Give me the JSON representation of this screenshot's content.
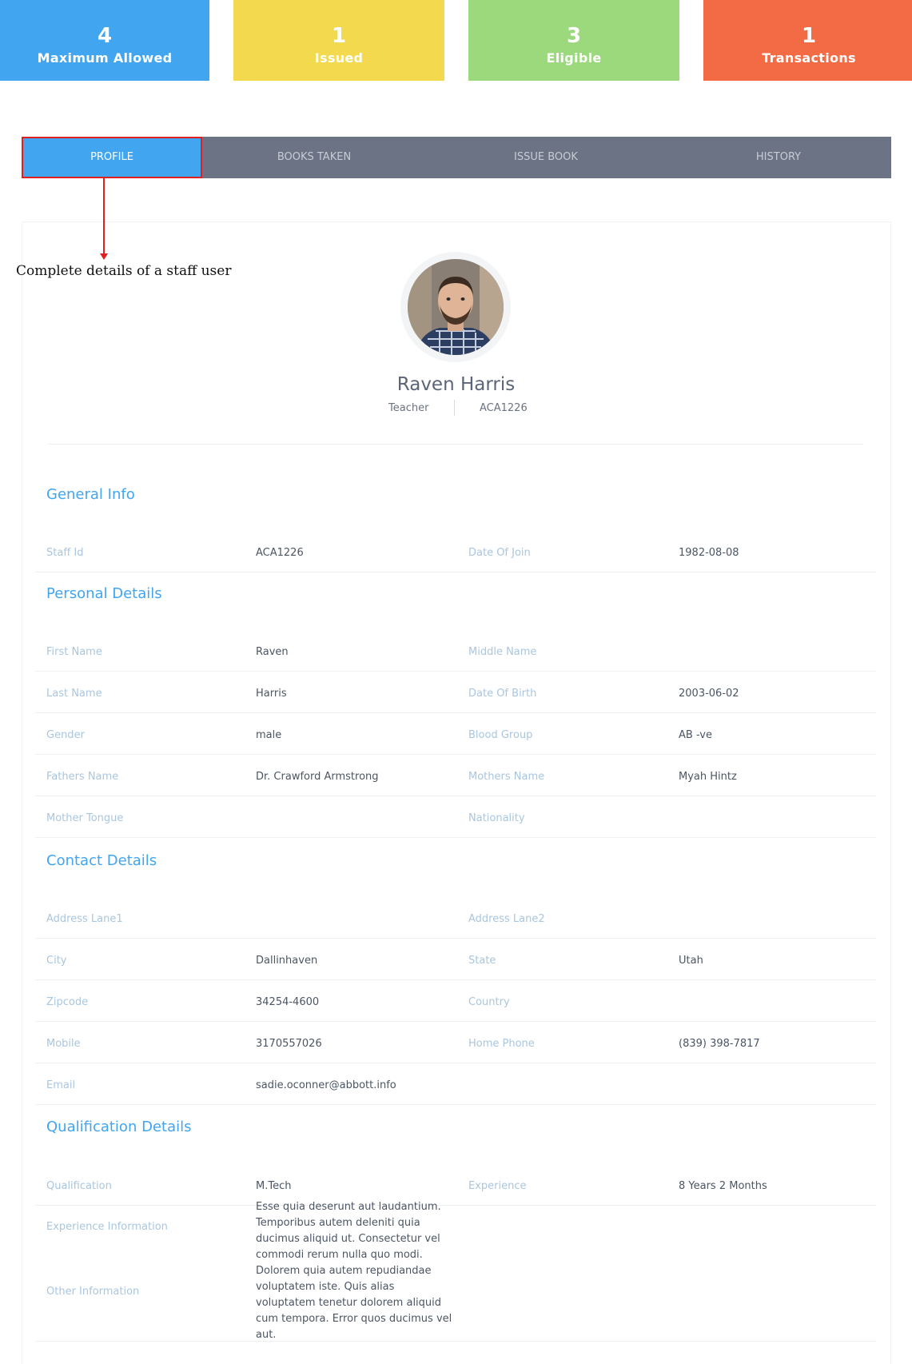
{
  "stats": [
    {
      "value": "4",
      "label": "Maximum Allowed",
      "color": "#42a5f0"
    },
    {
      "value": "1",
      "label": "Issued",
      "color": "#f3d94d"
    },
    {
      "value": "3",
      "label": "Eligible",
      "color": "#9bd97c"
    },
    {
      "value": "1",
      "label": "Transactions",
      "color": "#f26b45"
    }
  ],
  "tabs": [
    {
      "label": "PROFILE",
      "active": true
    },
    {
      "label": "BOOKS TAKEN"
    },
    {
      "label": "ISSUE BOOK"
    },
    {
      "label": "HISTORY"
    }
  ],
  "annotation": "Complete details of a staff user",
  "profile": {
    "name": "Raven Harris",
    "role": "Teacher",
    "id": "ACA1226",
    "avatar_icon": "user-photo"
  },
  "sections": {
    "general": "General Info",
    "personal": "Personal Details",
    "contact": "Contact  Details",
    "qualification": "Qualification Details"
  },
  "general": {
    "staff_id_label": "Staff Id",
    "staff_id": "ACA1226",
    "doj_label": "Date Of Join",
    "doj": "1982-08-08"
  },
  "personal": {
    "first_name_label": "First Name",
    "first_name": "Raven",
    "middle_name_label": "Middle Name",
    "middle_name": "",
    "last_name_label": "Last Name",
    "last_name": "Harris",
    "dob_label": "Date Of Birth",
    "dob": "2003-06-02",
    "gender_label": "Gender",
    "gender": "male",
    "blood_label": "Blood Group",
    "blood": "AB -ve",
    "father_label": "Fathers Name",
    "father": "Dr. Crawford Armstrong",
    "mother_label": "Mothers Name",
    "mother": "Myah Hintz",
    "tongue_label": "Mother Tongue",
    "tongue": "",
    "nationality_label": "Nationality",
    "nationality": ""
  },
  "contact": {
    "addr1_label": "Address Lane1",
    "addr1": "",
    "addr2_label": "Address Lane2",
    "addr2": "",
    "city_label": "City",
    "city": "Dallinhaven",
    "state_label": "State",
    "state": "Utah",
    "zip_label": "Zipcode",
    "zip": "34254-4600",
    "country_label": "Country",
    "country": "",
    "mobile_label": "Mobile",
    "mobile": "3170557026",
    "home_label": "Home Phone",
    "home": "(839) 398-7817",
    "email_label": "Email",
    "email": "sadie.oconner@abbott.info"
  },
  "qualification": {
    "qual_label": "Qualification",
    "qual": "M.Tech",
    "exp_label": "Experience",
    "exp": "8 Years 2 Months",
    "exp_info_label": "Experience Information",
    "other_info_label": "Other Information",
    "info_text": "Esse quia deserunt aut laudantium. Temporibus autem deleniti quia ducimus aliquid ut. Consectetur vel commodi rerum nulla quo modi. Dolorem quia autem repudiandae voluptatem iste. Quis alias voluptatem tenetur dolorem aliquid cum tempora. Error quos ducimus vel aut."
  }
}
